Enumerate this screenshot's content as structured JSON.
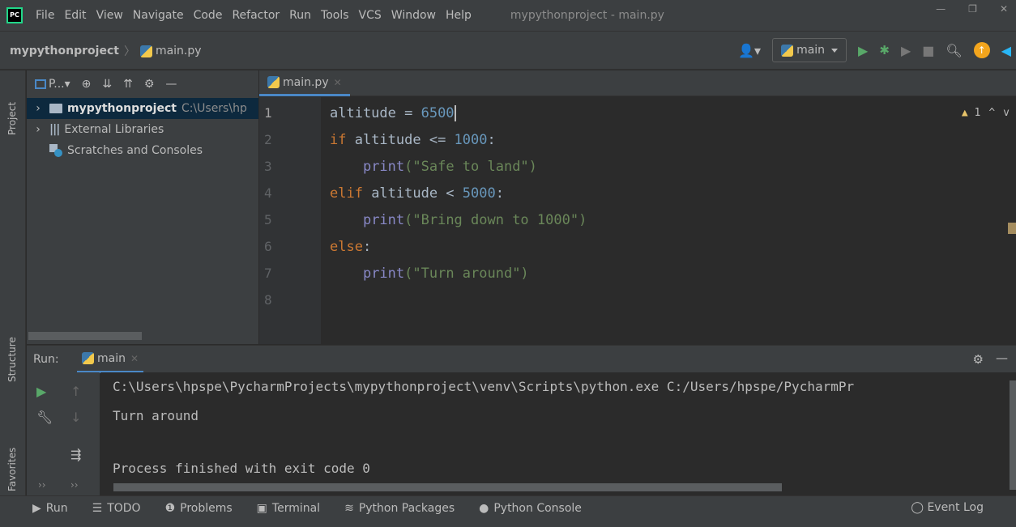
{
  "menubar": {
    "logo": "PC",
    "items": [
      "File",
      "Edit",
      "View",
      "Navigate",
      "Code",
      "Refactor",
      "Run",
      "Tools",
      "VCS",
      "Window",
      "Help"
    ],
    "window_title": "mypythonproject - main.py"
  },
  "navbar": {
    "project": "mypythonproject",
    "file": "main.py",
    "run_config": "main"
  },
  "left_strip": {
    "project_label": "Project",
    "structure_label": "Structure",
    "favorites_label": "Favorites"
  },
  "project_panel": {
    "toolbar_label": "P...",
    "tree": [
      {
        "label": "mypythonproject",
        "path": "C:\\Users\\hp"
      },
      {
        "label": "External Libraries"
      },
      {
        "label": "Scratches and Consoles"
      }
    ]
  },
  "editor": {
    "tab_label": "main.py",
    "warning_count": "1",
    "line_numbers": [
      "1",
      "2",
      "3",
      "4",
      "5",
      "6",
      "7",
      "8"
    ],
    "lines": [
      {
        "kw": "",
        "text": "altitude = ",
        "num": "6500",
        "rest": ""
      },
      {
        "kw": "if",
        "text": " altitude <= ",
        "num": "1000",
        "rest": ":"
      },
      {
        "fn": "print",
        "str": "(\"Safe to land\")"
      },
      {
        "kw": "elif",
        "text": " altitude < ",
        "num": "5000",
        "rest": ":"
      },
      {
        "fn": "print",
        "str": "(\"Bring down to 1000\")"
      },
      {
        "kw": "else",
        "text": ":"
      },
      {
        "fn": "print",
        "str": "(\"Turn around\")"
      }
    ]
  },
  "run_panel": {
    "label": "Run:",
    "tab": "main",
    "console": [
      "C:\\Users\\hpspe\\PycharmProjects\\mypythonproject\\venv\\Scripts\\python.exe C:/Users/hpspe/PycharmPr",
      "Turn around",
      "",
      "Process finished with exit code 0"
    ]
  },
  "bottom_bar": {
    "tabs": [
      "Run",
      "TODO",
      "Problems",
      "Terminal",
      "Python Packages",
      "Python Console"
    ],
    "event_log": "Event Log"
  }
}
